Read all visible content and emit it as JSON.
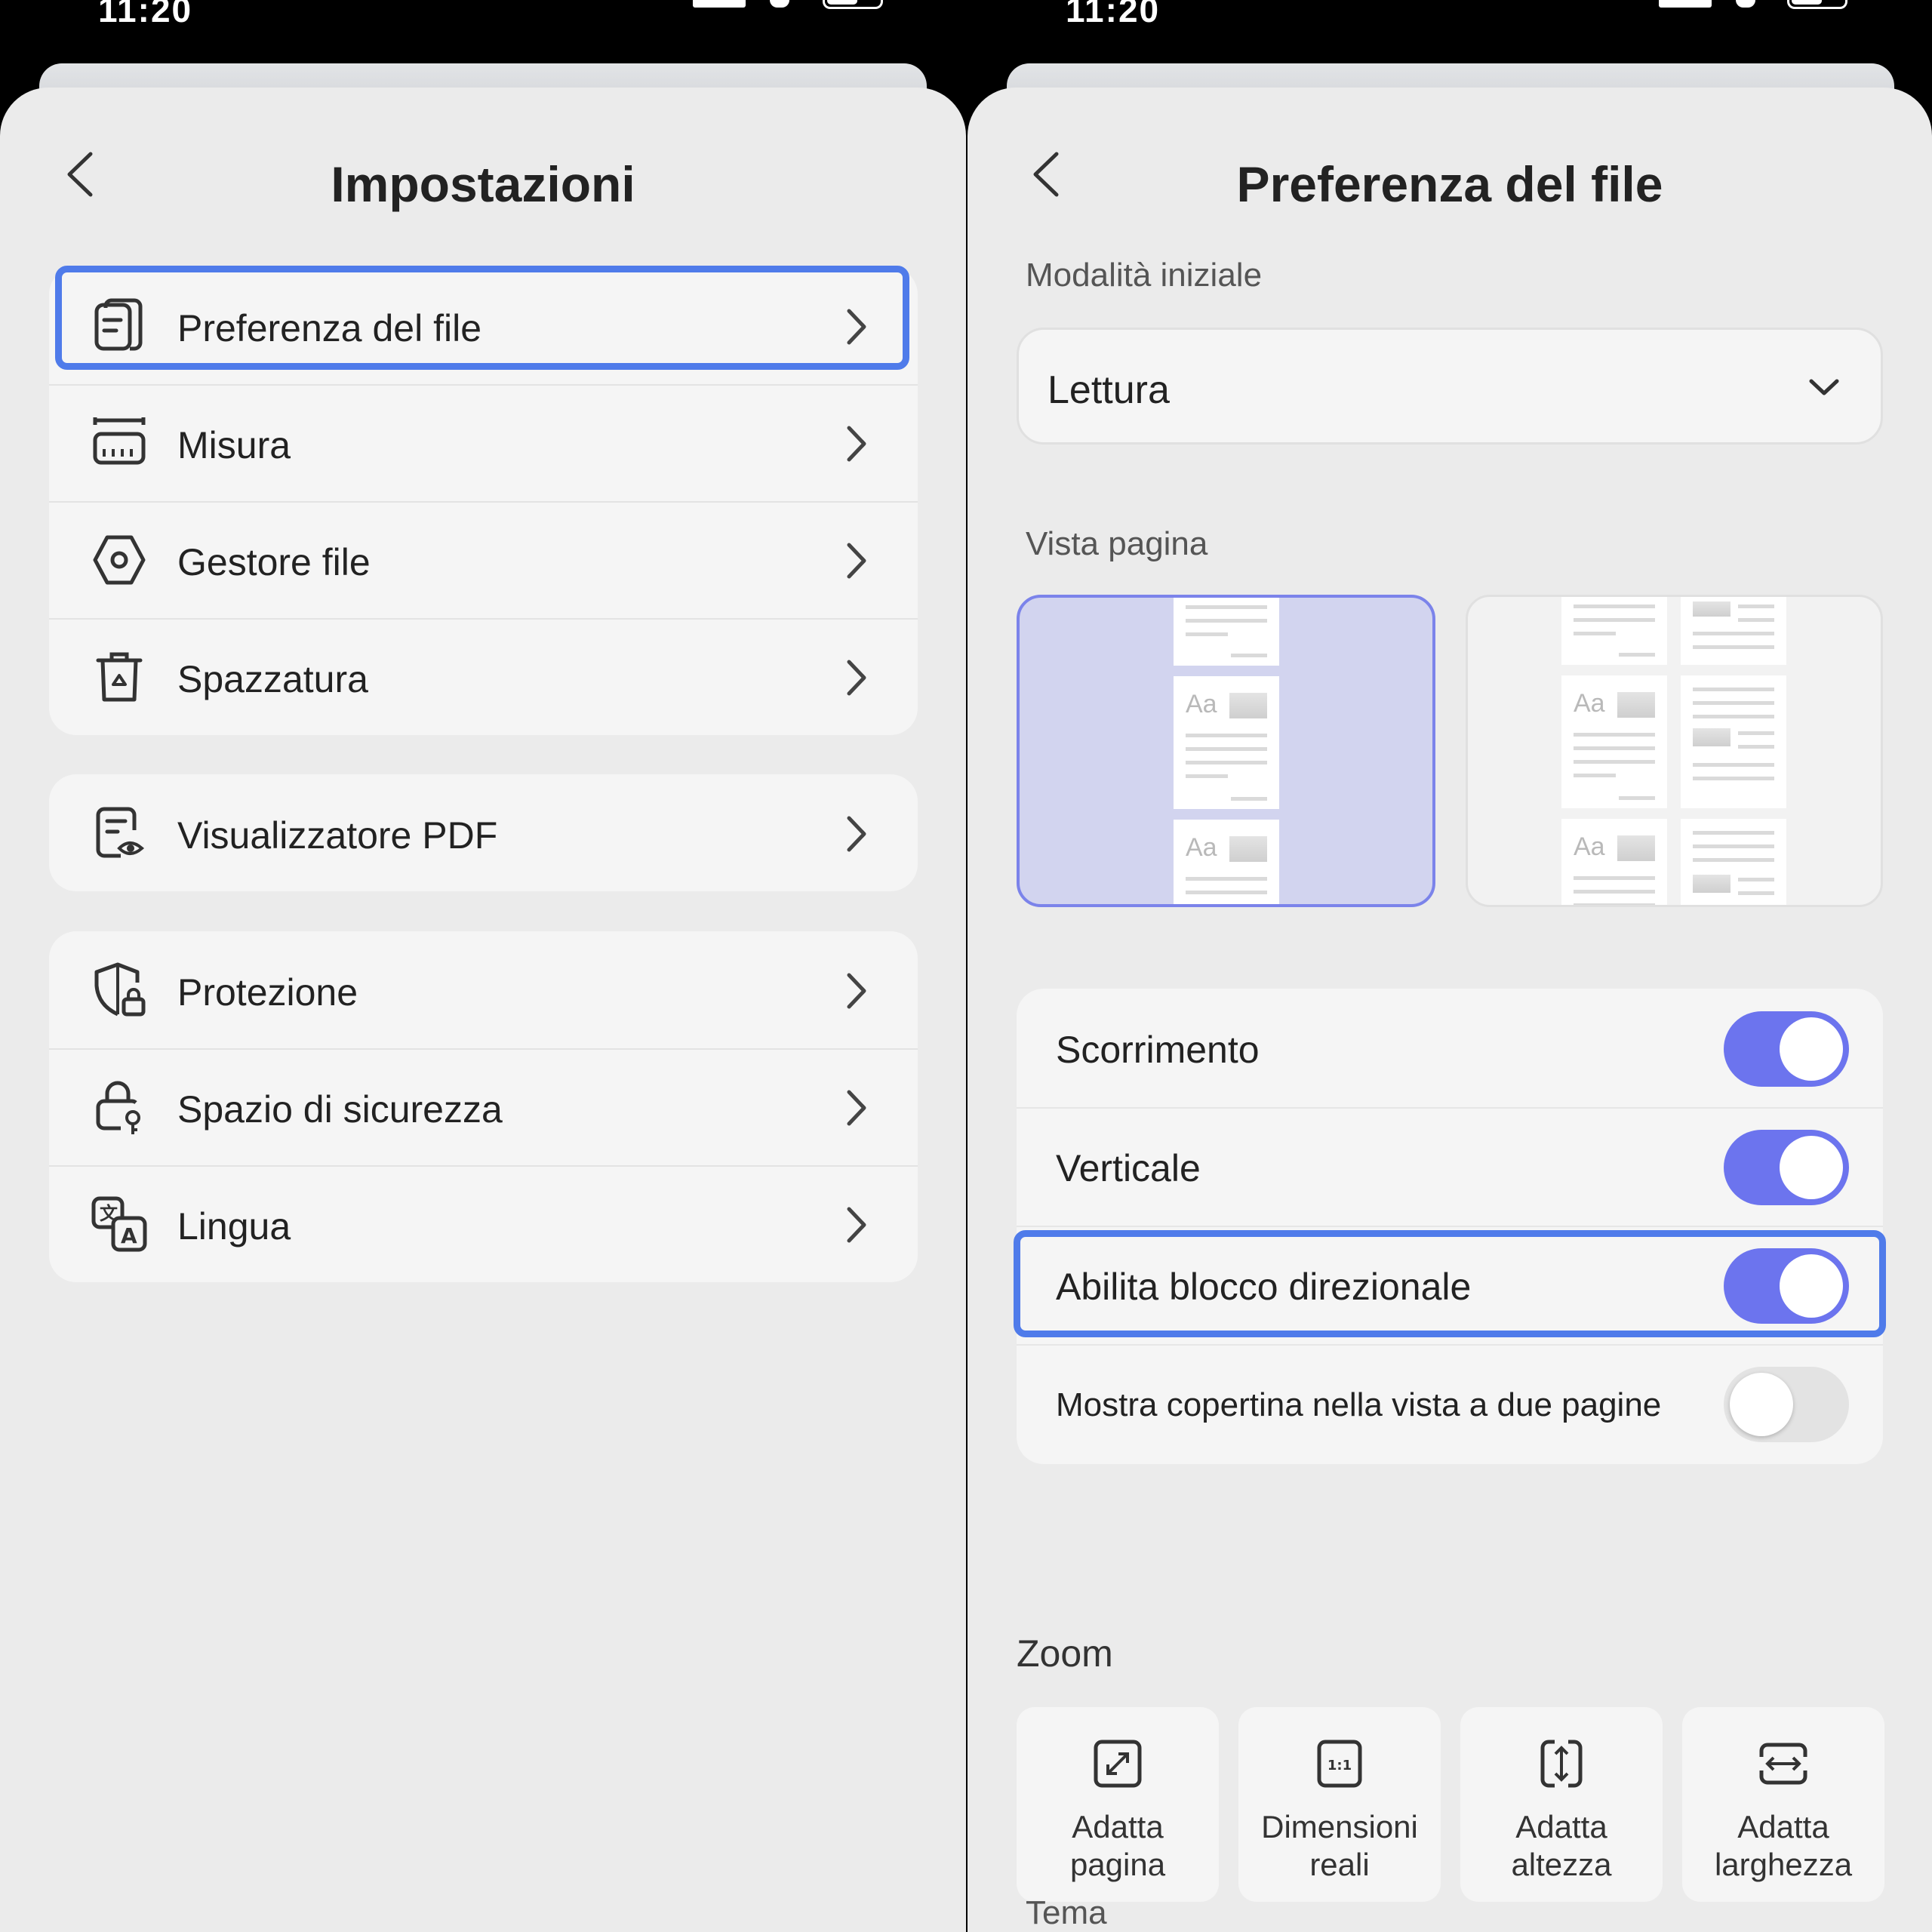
{
  "status_bar": {
    "time": "11:20"
  },
  "left": {
    "title": "Impostazioni",
    "group1": [
      {
        "label": "Preferenza del file",
        "icon": "file-preference-icon"
      },
      {
        "label": "Misura",
        "icon": "ruler-icon"
      },
      {
        "label": "Gestore file",
        "icon": "hexagon-gear-icon"
      },
      {
        "label": "Spazzatura",
        "icon": "trash-icon"
      }
    ],
    "group2": [
      {
        "label": "Visualizzatore PDF",
        "icon": "pdf-viewer-icon"
      }
    ],
    "group3": [
      {
        "label": "Protezione",
        "icon": "shield-lock-icon"
      },
      {
        "label": "Spazio di sicurezza",
        "icon": "lock-key-icon"
      },
      {
        "label": "Lingua",
        "icon": "translate-icon"
      }
    ]
  },
  "right": {
    "title": "Preferenza del file",
    "initial_mode": {
      "label": "Modalità iniziale",
      "value": "Lettura"
    },
    "page_view": {
      "label": "Vista pagina",
      "preview_text": "Aa",
      "selected": "single"
    },
    "toggles": [
      {
        "label": "Scorrimento",
        "on": true
      },
      {
        "label": "Verticale",
        "on": true
      },
      {
        "label": "Abilita blocco direzionale",
        "on": true
      },
      {
        "label": "Mostra copertina nella vista a due pagine",
        "on": false
      }
    ],
    "zoom": {
      "label": "Zoom",
      "options": [
        {
          "label": "Adatta\npagina",
          "icon": "fit-page-icon"
        },
        {
          "label": "Dimensioni\nreali",
          "icon": "actual-size-icon",
          "icon_text": "1:1"
        },
        {
          "label": "Adatta\naltezza",
          "icon": "fit-height-icon"
        },
        {
          "label": "Adatta\nlarghezza",
          "icon": "fit-width-icon"
        }
      ]
    },
    "theme": {
      "label": "Tema"
    }
  },
  "colors": {
    "accent": "#6c74ee",
    "highlight": "#4f7bea",
    "background": "#ebebeb",
    "card": "#f5f5f5"
  }
}
